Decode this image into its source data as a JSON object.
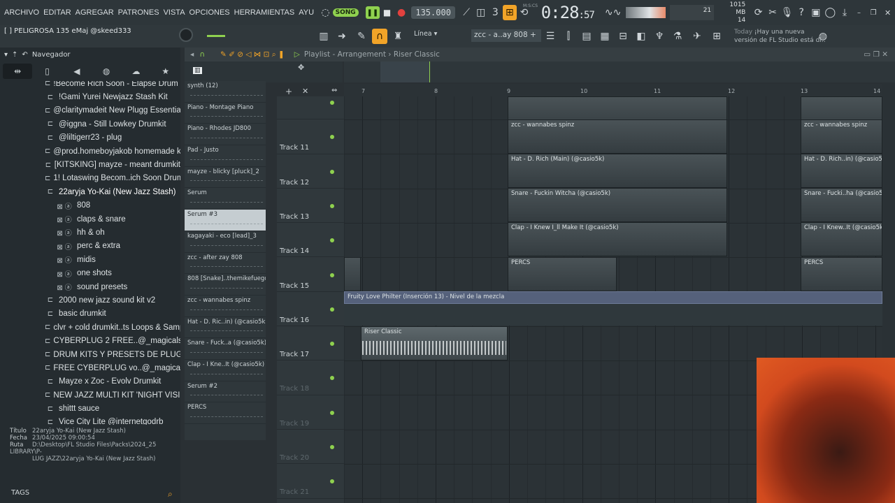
{
  "menu": [
    "ARCHIVO",
    "EDITAR",
    "AGREGAR",
    "PATRONES",
    "VISTA",
    "OPCIONES",
    "HERRAMIENTAS",
    "AYU"
  ],
  "transport": {
    "song_label": "SONG",
    "tempo": "135.000",
    "time_main": "0:28",
    "time_ms": ":57",
    "time_unit": "M:S:CS",
    "cpu_top": "21",
    "mem": "1015 MB",
    "poly": "14"
  },
  "hint": "[ ] PELIGROSA 135 eMaj @skeed333",
  "snap": "Línea",
  "pattern_sel": "zcc - a..ay 808",
  "news": {
    "today": "Today",
    "line1": "¡Hay una nueva",
    "line2": "versión de FL Studio está di.."
  },
  "browser": {
    "title": "Navegador",
    "items": [
      {
        "label": "!Become Rich Soon - Elapse Drum Kit Sk",
        "kind": "folder"
      },
      {
        "label": "!Gami Yurei Newjazz Stash Kit",
        "kind": "folder"
      },
      {
        "label": "@claritymadeit New Plugg Essentials Kit",
        "kind": "folder"
      },
      {
        "label": "@iggna - Still Lowkey Drumkit",
        "kind": "folder"
      },
      {
        "label": "@liltigerr23 - plug",
        "kind": "folder"
      },
      {
        "label": "@prod.homeboyjakob homemade kit",
        "kind": "folder"
      },
      {
        "label": "[KITSKING] mayze - meant drumkit",
        "kind": "folder"
      },
      {
        "label": "1! Lotaswing Becom..ich Soon Drum Kit",
        "kind": "folder"
      },
      {
        "label": "22aryja Yo-Kai (New Jazz Stash)",
        "kind": "folder-open"
      },
      {
        "label": "808",
        "kind": "sub"
      },
      {
        "label": "claps & snare",
        "kind": "sub"
      },
      {
        "label": "hh & oh",
        "kind": "sub"
      },
      {
        "label": "perc & extra",
        "kind": "sub"
      },
      {
        "label": "midis",
        "kind": "sub"
      },
      {
        "label": "one shots",
        "kind": "sub"
      },
      {
        "label": "sound presets",
        "kind": "sub"
      },
      {
        "label": "2000 new jazz sound kit v2",
        "kind": "folder"
      },
      {
        "label": "basic drumkit",
        "kind": "folder"
      },
      {
        "label": "clvr + cold drumkit..ts Loops & Samples)",
        "kind": "folder"
      },
      {
        "label": "CYBERPLUG 2 FREE..@_magicalsounds",
        "kind": "folder"
      },
      {
        "label": "DRUM KITS Y PRESETS DE PLUGG",
        "kind": "folder"
      },
      {
        "label": "FREE CYBERPLUG vo..@_magicalsounds",
        "kind": "folder"
      },
      {
        "label": "Mayze x Zoc - Evolv Drumkit",
        "kind": "folder"
      },
      {
        "label": "NEW JAZZ MULTI KIT 'NIGHT VISION'",
        "kind": "folder"
      },
      {
        "label": "shittt sauce",
        "kind": "folder"
      },
      {
        "label": "Vice City Lite @internetgodrb",
        "kind": "folder"
      }
    ],
    "meta": {
      "title_key": "Título",
      "title_val": "22aryja Yo-Kai (New Jazz Stash)",
      "date_key": "Fecha",
      "date_val": "23/04/2025 09:00:54",
      "path_key": "Ruta",
      "path_val1": "D:\\Desktop\\FL Studio Files\\Packs\\2024_25 LIBRARY\\P-",
      "path_val2": "LUG JAZZ\\22aryja Yo-Kai (New Jazz Stash)"
    },
    "tags": "TAGS"
  },
  "playlist": {
    "title": "Playlist - Arrangement › Riser Classic"
  },
  "channels": [
    "synth (12)",
    "Piano - Montage Piano",
    "Piano - Rhodes JD800",
    "Pad - Justo",
    "mayze - blicky [pluck]_2",
    "Serum",
    "Serum #3",
    "kagayaki - eco [lead]_3",
    "zcc - after zay 808",
    "808 [Snake]..themikefuego",
    "zcc - wannabes spinz",
    "Hat - D. Ric..in) (@casio5k)",
    "Snare - Fuck..a (@casio5k)",
    "Clap - I Kne..It (@casio5k)",
    "Serum #2",
    "PERCS"
  ],
  "ruler": [
    "7",
    "8",
    "9",
    "10",
    "11",
    "12",
    "13",
    "14"
  ],
  "tracks": [
    "",
    "Track 11",
    "Track 12",
    "Track 13",
    "Track 14",
    "Track 15",
    "Track 16",
    "Track 17",
    "Track 18",
    "Track 19",
    "Track 20",
    "Track 21"
  ],
  "clips": {
    "c11a": "zcc - wannabes spinz",
    "c11b": "zcc - wannabes spinz",
    "c12a": "Hat - D. Rich (Main) (@casio5k)",
    "c12b": "Hat - D. Rich..in) (@casio5k)",
    "c13a": "Snare - Fuckin Witcha (@casio5k)",
    "c13b": "Snare - Fucki..ha (@casio5k)",
    "c14a": "Clap - I Knew I_ll Make It (@casio5k)",
    "c14b": "Clap - I Knew..It (@casio5k)",
    "c15a": "PERCS",
    "c15b": "PERCS",
    "c16": "Fruity Love Philter (Inserción 13) - Nivel de la mezcla",
    "c17": "Riser Classic"
  }
}
